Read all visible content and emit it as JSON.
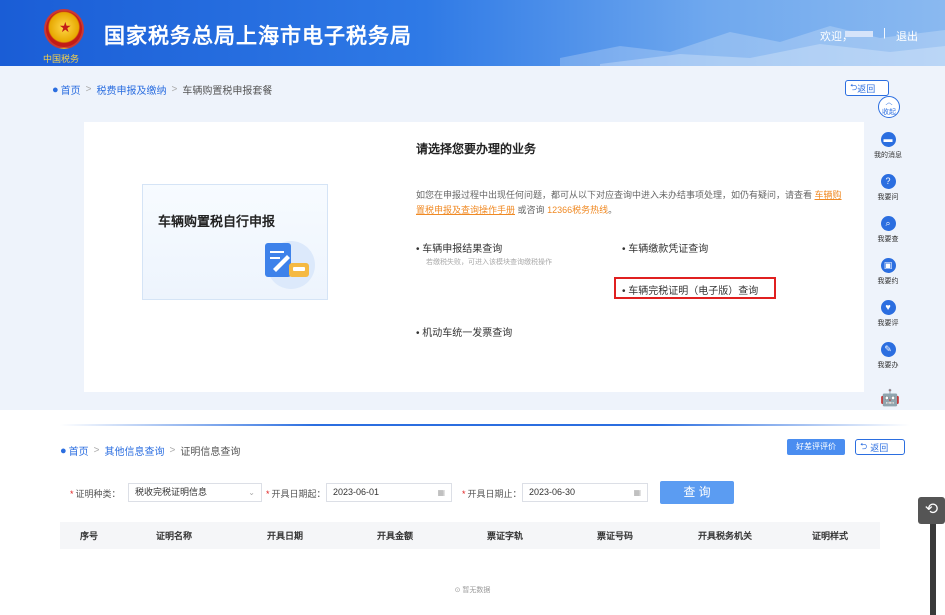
{
  "top": {
    "header": {
      "logo_text": "中国税务",
      "title": "国家税务总局上海市电子税务局",
      "welcome": "欢迎，",
      "separator": "|",
      "logout": "退出"
    },
    "breadcrumb": {
      "home": "首页",
      "level2": "税费申报及缴纳",
      "current": "车辆购置税申报套餐"
    },
    "back_label": "返回",
    "service_card": {
      "title": "车辆购置税自行申报"
    },
    "choose_title": "请选择您要办理的业务",
    "intro": {
      "part1": "如您在申报过程中出现任何问题，都可从以下对应查询中进入未办结事项处理，如仍有疑问，请查看",
      "manual_link": "车辆购置税申报及查询操作手册",
      "part2": "或咨询",
      "hotline": "12366税务热线",
      "end": "。"
    },
    "options": [
      {
        "label": "车辆申报结果查询",
        "note": "若缴税失败，可进入该模块查询缴税操作"
      },
      {
        "label": "车辆缴款凭证查询"
      },
      {
        "label": "车辆完税证明（电子版）查询"
      },
      {
        "label": "机动车统一发票查询"
      }
    ],
    "sidebar": {
      "collapse": "收起",
      "items": [
        {
          "label": "我的消息",
          "icon": "message-icon"
        },
        {
          "label": "我要问",
          "icon": "question-icon"
        },
        {
          "label": "我要查",
          "icon": "search-icon"
        },
        {
          "label": "我要约",
          "icon": "appointment-icon"
        },
        {
          "label": "我要评",
          "icon": "heart-icon"
        },
        {
          "label": "我要办",
          "icon": "pen-icon"
        }
      ]
    }
  },
  "bottom": {
    "breadcrumb": {
      "home": "首页",
      "level2": "其他信息查询",
      "current": "证明信息查询"
    },
    "rating_label": "好差评评价",
    "back_label": "返回",
    "form": {
      "type_label": "证明种类：",
      "type_value": "税收完税证明信息",
      "start_label": "开具日期起：",
      "start_value": "2023-06-01",
      "end_label": "开具日期止：",
      "end_value": "2023-06-30",
      "query_label": "查 询"
    },
    "table": {
      "columns": [
        "序号",
        "证明名称",
        "开具日期",
        "开具金额",
        "票证字轨",
        "票证号码",
        "开具税务机关",
        "证明样式"
      ]
    },
    "empty_text": "暂无数据"
  },
  "colors": {
    "primary": "#2b6ee0",
    "highlight_border": "#e02020",
    "link_orange": "#f08a24"
  }
}
